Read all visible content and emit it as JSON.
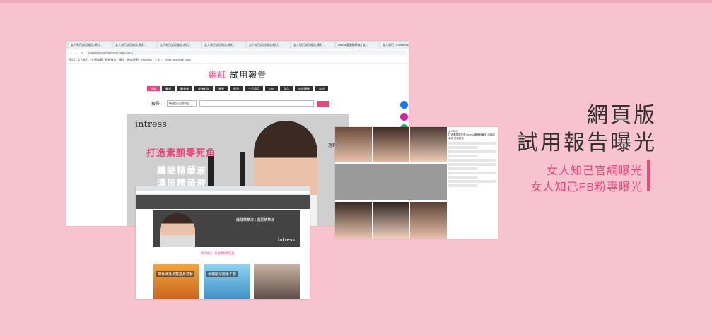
{
  "browser": {
    "tabs": [
      "女人知己試用報告-網紅...",
      "女人知己試用報告-網紅...",
      "女人知己試用報告-網紅...",
      "女人知己試用報告-網紅...",
      "女人知己試用報告-網紅...",
      "女人知己試用報告-網紅...",
      "intress濃眉精華液 | 女...",
      "女人知己 | Facebook"
    ],
    "url": "justwoman.tw/trial/report.aspx?id=1",
    "bookmarks": "應用 · 女人知己 · 社團編輯 · 臉書廣告 · 廣告 · 網站規劃 · YouTube · 文字... · Meta Business Suite"
  },
  "site": {
    "title_pink": "網紅",
    "title_rest": " 試用報告",
    "nav": [
      "全部",
      "醫美",
      "醫美美",
      "保養彩妝",
      "髮髮",
      "瘦身",
      "生活用品",
      "SPA",
      "食品",
      "旅遊體驗",
      "其他"
    ],
    "search_label": "搜尋：",
    "search_select": "精選品/主題內容"
  },
  "banner": {
    "brand": "intress",
    "headline": "打造素顏零死角",
    "line1": "纖睫精華液",
    "line2": "濃眉精華液",
    "endorser": "理科太太"
  },
  "inset": {
    "banner_text": "纖睫精華液 | 濃眉精華液",
    "banner_brand": "intress",
    "caption": "試用報告 · 打造素顏零死角",
    "card1": "蔬食凍盞多雙瘦身套餐",
    "card2": "水楊酸深層手工皂"
  },
  "fb": {
    "page_name": "女人知己",
    "post_text": "打造素顏零死角 intress 纖睫精華液 濃眉精華液 試用報告"
  },
  "text": {
    "title1": "網頁版",
    "title2": "試用報告曝光",
    "sub1": "女人知己官網曝光",
    "sub2": "女人知己FB粉專曝光"
  },
  "colors": {
    "background": "#f7c3cf",
    "accent": "#e8467e",
    "facebook": "#1877f2",
    "instagram": "#d6249f",
    "line": "#06c755"
  }
}
